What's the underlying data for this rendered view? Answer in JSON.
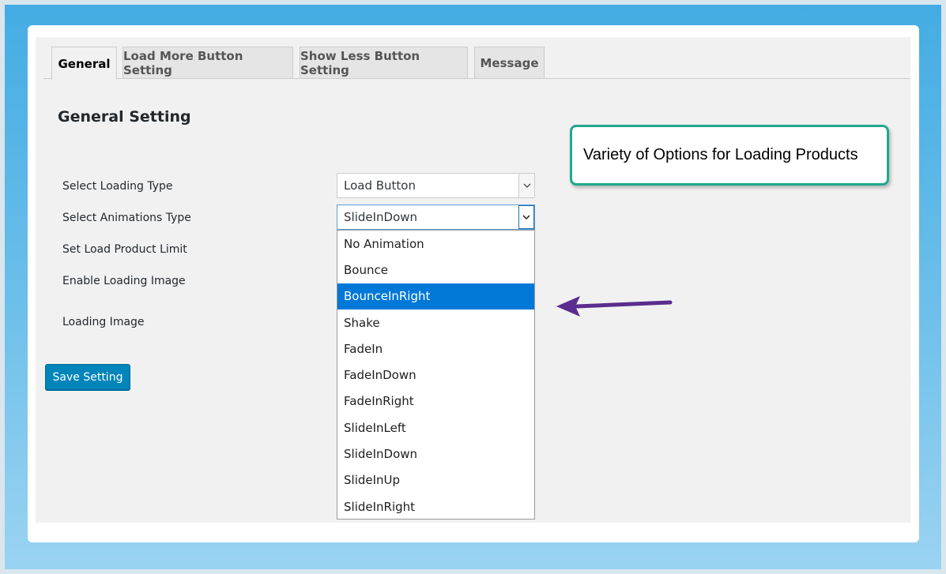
{
  "tabs": [
    {
      "label": "General",
      "active": true
    },
    {
      "label": "Load More Button Setting",
      "active": false
    },
    {
      "label": "Show Less Button Setting",
      "active": false
    },
    {
      "label": "Message",
      "active": false
    }
  ],
  "section_title": "General Setting",
  "fields": {
    "loading_type": {
      "label": "Select Loading Type",
      "value": "Load Button"
    },
    "animation_type": {
      "label": "Select Animations Type",
      "value": "SlideInDown"
    },
    "product_limit": {
      "label": "Set Load Product Limit"
    },
    "enable_loading_image": {
      "label": "Enable Loading Image"
    },
    "loading_image": {
      "label": "Loading Image"
    }
  },
  "animation_options": [
    "No Animation",
    "Bounce",
    "BounceInRight",
    "Shake",
    "FadeIn",
    "FadeInDown",
    "FadeInRight",
    "SlideInLeft",
    "SlideInDown",
    "SlideInUp",
    "SlideInRight"
  ],
  "highlighted_option": "BounceInRight",
  "save_button_label": "Save Setting",
  "callout_text": "Variety of Options for Loading Products",
  "colors": {
    "accent_blue": "#0085ba",
    "highlight": "#0078d7",
    "callout_border": "#1fa98b",
    "arrow": "#5b2d8e"
  },
  "icons": {
    "select_arrow": "chevron-down-icon",
    "annotation": "left-arrow-icon"
  }
}
